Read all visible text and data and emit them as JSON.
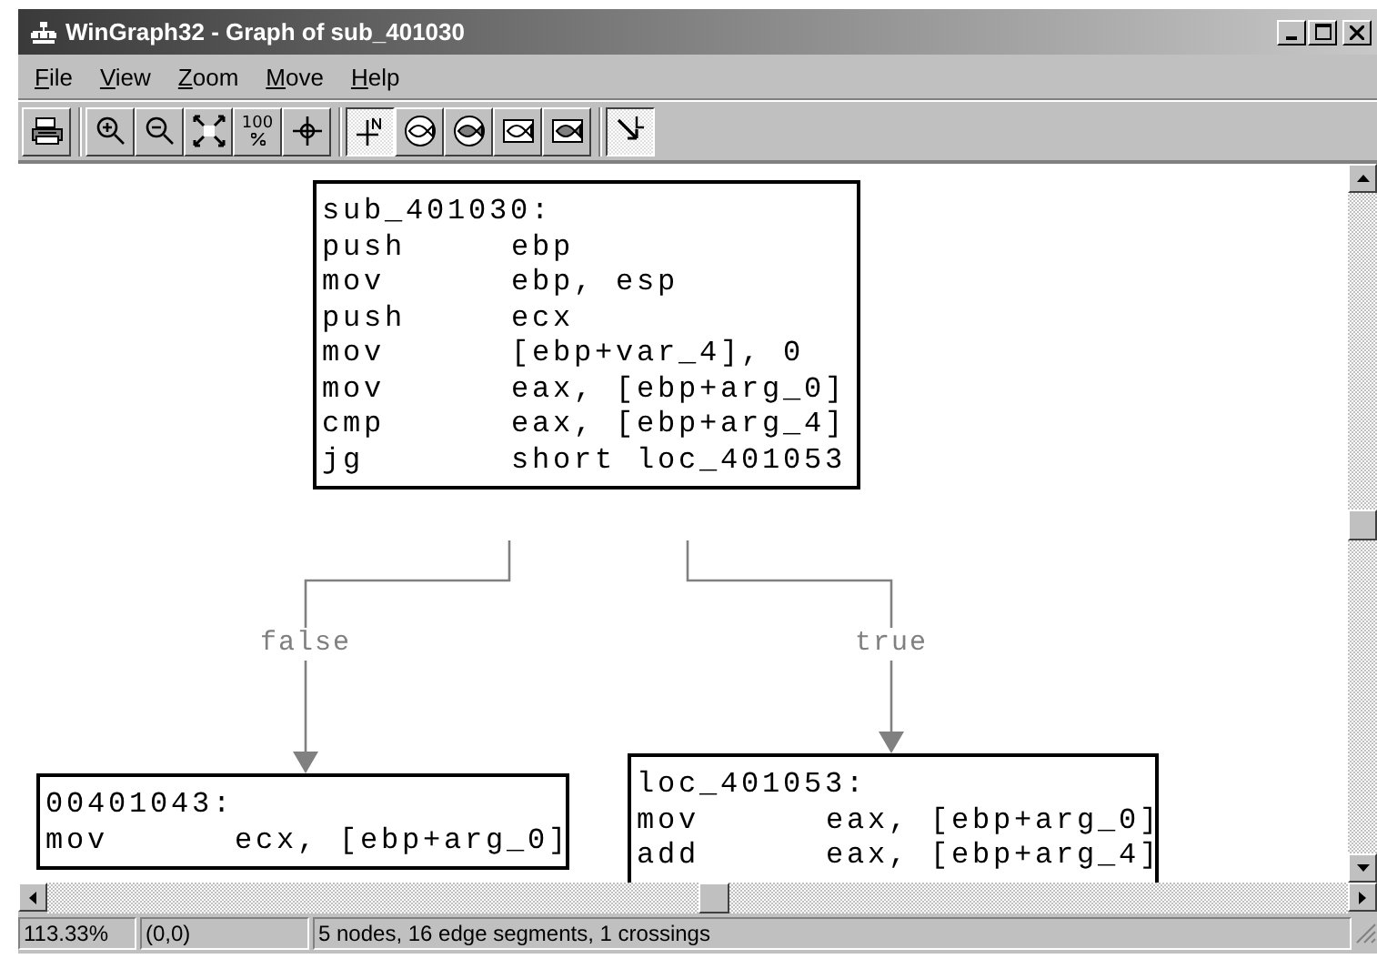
{
  "window": {
    "title": "WinGraph32 - Graph of sub_401030"
  },
  "menu": [
    {
      "label": "File"
    },
    {
      "label": "View"
    },
    {
      "label": "Zoom"
    },
    {
      "label": "Move"
    },
    {
      "label": "Help"
    }
  ],
  "toolbar": [
    [
      {
        "kind": "print",
        "pressed": false
      }
    ],
    [
      {
        "kind": "zoom-in",
        "pressed": false
      },
      {
        "kind": "zoom-out",
        "pressed": false
      },
      {
        "kind": "fit",
        "pressed": false
      },
      {
        "kind": "percent",
        "text": "100",
        "pressed": false
      },
      {
        "kind": "center",
        "pressed": false
      }
    ],
    [
      {
        "kind": "north",
        "pressed": true
      },
      {
        "kind": "fish-outline",
        "pressed": false
      },
      {
        "kind": "fish-filled",
        "pressed": false
      },
      {
        "kind": "fish-box",
        "pressed": false
      },
      {
        "kind": "fish-box-filled",
        "pressed": false
      }
    ],
    [
      {
        "kind": "arrow-l",
        "pressed": true
      }
    ]
  ],
  "graph": {
    "nodes": [
      {
        "title": "sub_401030:",
        "lines": [
          {
            "mnemonic": "push",
            "operands": "ebp"
          },
          {
            "mnemonic": "mov",
            "operands": "ebp, esp"
          },
          {
            "mnemonic": "push",
            "operands": "ecx"
          },
          {
            "mnemonic": "mov",
            "operands": "[ebp+var_4], 0"
          },
          {
            "mnemonic": "mov",
            "operands": "eax, [ebp+arg_0]"
          },
          {
            "mnemonic": "cmp",
            "operands": "eax, [ebp+arg_4]"
          },
          {
            "mnemonic": "jg",
            "operands": "short loc_401053"
          }
        ]
      },
      {
        "title": "00401043:",
        "lines": [
          {
            "mnemonic": "mov",
            "operands": "ecx, [ebp+arg_0]"
          }
        ]
      },
      {
        "title": "loc_401053:",
        "lines": [
          {
            "mnemonic": "mov",
            "operands": "eax, [ebp+arg_0]"
          },
          {
            "mnemonic": "add",
            "operands": "eax, [ebp+arg_4]"
          }
        ]
      }
    ],
    "edges": [
      {
        "label": "false"
      },
      {
        "label": "true"
      }
    ]
  },
  "status_bar": {
    "zoom": "113.33%",
    "position": "(0,0)",
    "message": "5 nodes, 16 edge segments, 1 crossings"
  }
}
